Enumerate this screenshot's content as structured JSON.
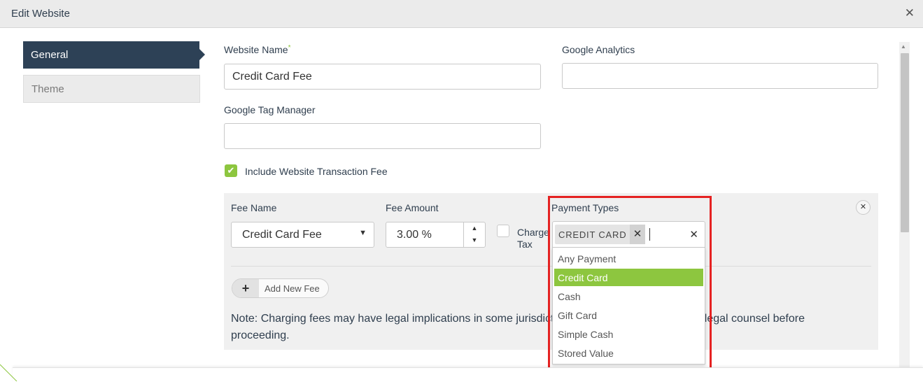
{
  "dialog": {
    "title": "Edit Website"
  },
  "sidebar": {
    "items": [
      {
        "label": "General",
        "active": true
      },
      {
        "label": "Theme",
        "active": false
      }
    ]
  },
  "form": {
    "website_name_label": "Website Name",
    "required_marker": "*",
    "website_name_value": "Credit Card Fee",
    "google_analytics_label": "Google Analytics",
    "google_analytics_value": "",
    "google_tag_manager_label": "Google Tag Manager",
    "google_tag_manager_value": "",
    "include_fee_label": "Include Website Transaction Fee",
    "include_fee_checked": true
  },
  "fee": {
    "fee_name_label": "Fee Name",
    "fee_name_value": "Credit Card Fee",
    "fee_amount_label": "Fee Amount",
    "fee_amount_value": "3.00 %",
    "charge_tax_label": "Charge Tax",
    "charge_tax_checked": false,
    "payment_types_label": "Payment Types",
    "selected_tag": "CREDIT CARD",
    "options": [
      "Any Payment",
      "Credit Card",
      "Cash",
      "Gift Card",
      "Simple Cash",
      "Stored Value"
    ],
    "highlighted_option": "Credit Card",
    "add_fee_label": "Add New Fee",
    "note": "Note: Charging fees may have legal implications in some jurisdictions. Please consult with your legal counsel before proceeding."
  },
  "icons": {
    "close": "✕",
    "dropdown": "▼",
    "spin_up": "▲",
    "spin_down": "▼",
    "plus": "+",
    "check": "✔",
    "remove": "✕",
    "tag_remove": "✕"
  },
  "colors": {
    "accent": "#8dc63f",
    "nav_active": "#2d4156",
    "highlight_box": "#e52222"
  }
}
